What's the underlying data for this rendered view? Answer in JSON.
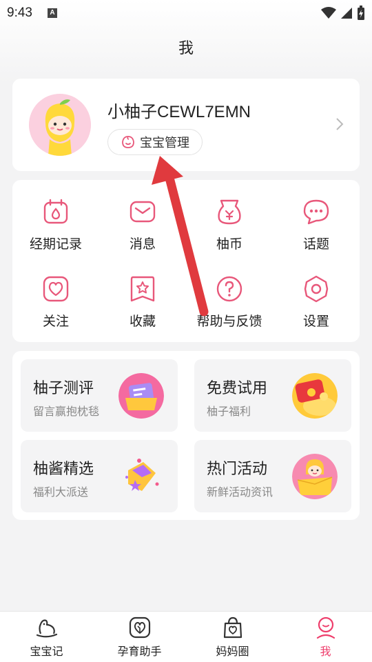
{
  "status_bar": {
    "time": "9:43",
    "notification_icon": "A"
  },
  "header": {
    "title": "我"
  },
  "profile": {
    "username": "小柚子CEWL7EMN",
    "baby_button_label": "宝宝管理"
  },
  "menu": {
    "items": [
      {
        "label": "经期记录",
        "icon": "calendar-drop-icon"
      },
      {
        "label": "消息",
        "icon": "envelope-icon"
      },
      {
        "label": "柚币",
        "icon": "coin-pouch-icon"
      },
      {
        "label": "话题",
        "icon": "chat-bubble-icon"
      },
      {
        "label": "关注",
        "icon": "heart-icon"
      },
      {
        "label": "收藏",
        "icon": "star-bookmark-icon"
      },
      {
        "label": "帮助与反馈",
        "icon": "help-icon"
      },
      {
        "label": "设置",
        "icon": "gear-icon"
      }
    ]
  },
  "promos": [
    {
      "title": "柚子测评",
      "subtitle": "留言赢抱枕毯"
    },
    {
      "title": "免费试用",
      "subtitle": "柚子福利"
    },
    {
      "title": "柚酱精选",
      "subtitle": "福利大派送"
    },
    {
      "title": "热门活动",
      "subtitle": "新鲜活动资讯"
    }
  ],
  "tabs": [
    {
      "label": "宝宝记",
      "active": false
    },
    {
      "label": "孕育助手",
      "active": false
    },
    {
      "label": "妈妈圈",
      "active": false
    },
    {
      "label": "我",
      "active": true
    }
  ],
  "colors": {
    "accent": "#ee3d6b",
    "icon_pink": "#e8577a",
    "annotation_arrow": "#e03a3e"
  }
}
